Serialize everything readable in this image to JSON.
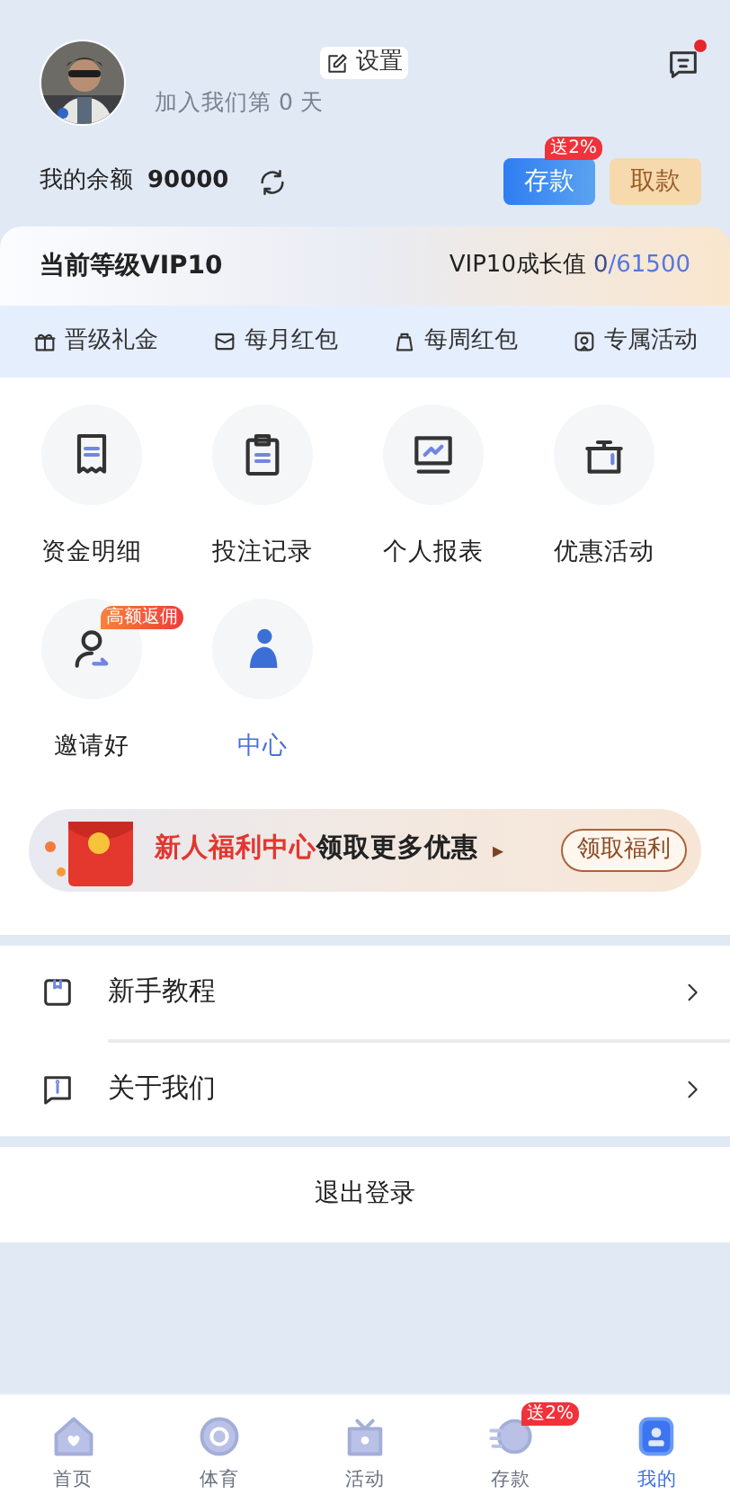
{
  "profile": {
    "settings": "设置",
    "joined": "加入我们第 0 天",
    "unread": true
  },
  "balance": {
    "label": "我的余额",
    "amount": "90000"
  },
  "deposit": {
    "label": "存款",
    "badge": "送2%"
  },
  "withdraw": {
    "label": "取款"
  },
  "vip": {
    "level": "当前等级VIP10",
    "growth_label": "VIP10成长值",
    "growth_current": "0",
    "growth_target": "/61500"
  },
  "perks": [
    {
      "label": "晋级礼金"
    },
    {
      "label": "每月红包"
    },
    {
      "label": "每周红包"
    },
    {
      "label": "专属活动"
    }
  ],
  "shortcuts": [
    {
      "label": "资金明细",
      "accent": false
    },
    {
      "label": "投注记录",
      "accent": false
    },
    {
      "label": "个人报表",
      "accent": false
    },
    {
      "label": "优惠活动",
      "accent": false
    },
    {
      "label": "邀请好",
      "accent": false,
      "badge": "高额返佣"
    },
    {
      "label": "中心",
      "accent": true
    }
  ],
  "banner": {
    "highlight": "新人福利中心",
    "text": "领取更多优惠",
    "arrow": "▸",
    "button": "领取福利"
  },
  "menu": [
    {
      "label": "新手教程"
    },
    {
      "label": "关于我们"
    }
  ],
  "logout": "退出登录",
  "nav": [
    {
      "label": "首页",
      "selected": false
    },
    {
      "label": "体育",
      "selected": false
    },
    {
      "label": "活动",
      "selected": false
    },
    {
      "label": "存款",
      "selected": false,
      "badge": "送2%"
    },
    {
      "label": "我的",
      "selected": true
    }
  ]
}
